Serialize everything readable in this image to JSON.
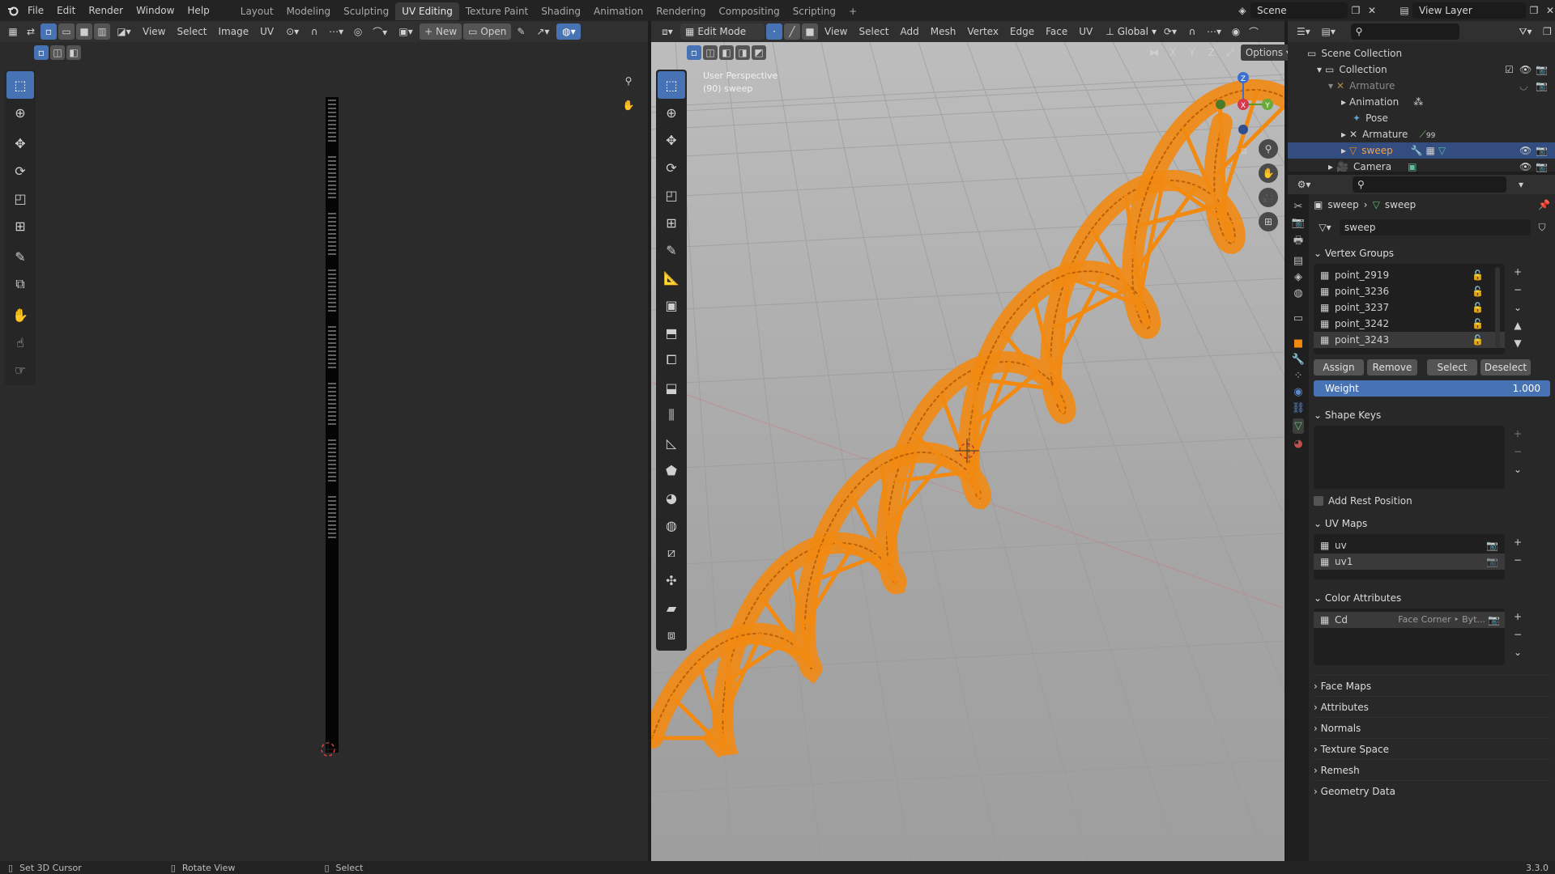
{
  "topbar": {
    "menus": [
      "File",
      "Edit",
      "Render",
      "Window",
      "Help"
    ],
    "workspaces": [
      "Layout",
      "Modeling",
      "Sculpting",
      "UV Editing",
      "Texture Paint",
      "Shading",
      "Animation",
      "Rendering",
      "Compositing",
      "Scripting"
    ],
    "active_workspace": "UV Editing",
    "add_tab": "+",
    "scene_name": "Scene",
    "view_layer": "View Layer"
  },
  "uv_editor": {
    "menus": [
      "View",
      "Select",
      "Image",
      "UV"
    ],
    "new_label": "New",
    "open_label": "Open"
  },
  "viewport": {
    "mode": "Edit Mode",
    "menus": [
      "View",
      "Select",
      "Add",
      "Mesh",
      "Vertex",
      "Edge",
      "Face",
      "UV"
    ],
    "orientation": "Global",
    "options_label": "Options",
    "axis_labels": [
      "X",
      "Y",
      "Z"
    ],
    "overlay_title": "User Perspective",
    "overlay_subtitle": "(90) sweep",
    "gizmo": {
      "x": "X",
      "y": "Y",
      "z": "Z"
    }
  },
  "outliner": {
    "rows": [
      {
        "label": "Scene Collection",
        "indent": 0
      },
      {
        "label": "Collection",
        "indent": 1
      },
      {
        "label": "Armature",
        "indent": 2
      },
      {
        "label": "Animation",
        "indent": 3
      },
      {
        "label": "Pose",
        "indent": 3
      },
      {
        "label": "Armature",
        "indent": 3
      },
      {
        "label": "sweep",
        "indent": 3
      },
      {
        "label": "Camera",
        "indent": 2
      }
    ],
    "armature_badge": "99"
  },
  "properties": {
    "breadcrumb": [
      "sweep",
      "sweep"
    ],
    "mesh_name": "sweep",
    "vertex_groups_title": "Vertex Groups",
    "vertex_groups": [
      "point_2919",
      "point_3236",
      "point_3237",
      "point_3242",
      "point_3243"
    ],
    "vg_buttons": [
      "Assign",
      "Remove",
      "Select",
      "Deselect"
    ],
    "weight_label": "Weight",
    "weight_value": "1.000",
    "shape_keys_title": "Shape Keys",
    "add_rest_position": "Add Rest Position",
    "uv_maps_title": "UV Maps",
    "uv_maps": [
      "uv",
      "uv1"
    ],
    "color_attributes_title": "Color Attributes",
    "color_attr_name": "Cd",
    "color_attr_type": "Face Corner ‣ Byt...",
    "collapsed_panels": [
      "Face Maps",
      "Attributes",
      "Normals",
      "Texture Space",
      "Remesh",
      "Geometry Data"
    ]
  },
  "statusbar": {
    "items": [
      "Set 3D Cursor",
      "Rotate View",
      "Select"
    ],
    "version": "3.3.0"
  },
  "colors": {
    "accent": "#4772b3",
    "mesh_orange": "#f28a12",
    "selected_row": "#334d80"
  }
}
